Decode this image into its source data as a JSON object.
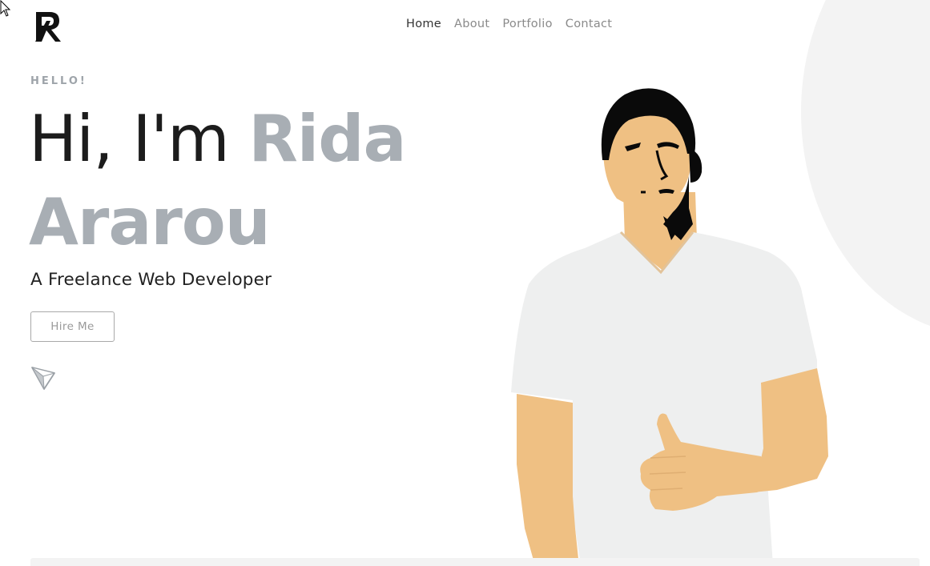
{
  "header": {
    "logo_icon": "ra-monogram-logo",
    "nav": [
      {
        "label": "Home",
        "active": true
      },
      {
        "label": "About",
        "active": false
      },
      {
        "label": "Portfolio",
        "active": false
      },
      {
        "label": "Contact",
        "active": false
      }
    ]
  },
  "hero": {
    "eyebrow": "HELLO!",
    "greeting": "Hi, I'm ",
    "name": "Rida Ararou",
    "subtitle": "A Freelance Web Developer",
    "cta_label": "Hire Me",
    "send_icon": "paper-plane-icon",
    "illustration": "developer-thumbs-up-illustration"
  },
  "colors": {
    "name_gray": "#a8aeb4",
    "text_dark": "#1c1c1c",
    "nav_inactive": "#8a8a8a",
    "skin": "#efc083",
    "shirt": "#eeefef",
    "background_shape": "#f3f3f3"
  }
}
